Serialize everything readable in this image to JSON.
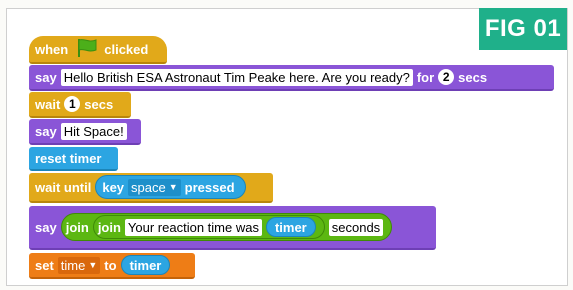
{
  "figure_label": "FIG 01",
  "blocks": {
    "when_clicked": {
      "when": "when",
      "clicked": "clicked"
    },
    "say_for": {
      "say": "say",
      "message": "Hello British ESA Astronaut Tim Peake here. Are you ready?",
      "for": "for",
      "secs_value": "2",
      "secs": "secs"
    },
    "wait": {
      "wait": "wait",
      "value": "1",
      "secs": "secs"
    },
    "say_hit": {
      "say": "say",
      "message": "Hit Space!"
    },
    "reset_timer": {
      "label": "reset timer"
    },
    "wait_until": {
      "wait_until": "wait until",
      "key": "key",
      "key_option": "space",
      "pressed": "pressed"
    },
    "say_join": {
      "say": "say",
      "join_outer": "join",
      "join_inner": "join",
      "text": "Your reaction time was",
      "timer": "timer",
      "suffix": "seconds"
    },
    "set_var": {
      "set": "set",
      "variable": "time",
      "to": "to",
      "value": "timer"
    }
  },
  "colors": {
    "looks": "#8a55d7",
    "control": "#e1a91a",
    "sensing": "#2ca5e2",
    "operators": "#5cb712",
    "variables": "#ee7d16",
    "fig_label": "#1fb08a",
    "flag": "#4caf1a"
  },
  "icons": {
    "green_flag": "green-flag-icon",
    "dropdown": "dropdown-arrow-icon"
  }
}
